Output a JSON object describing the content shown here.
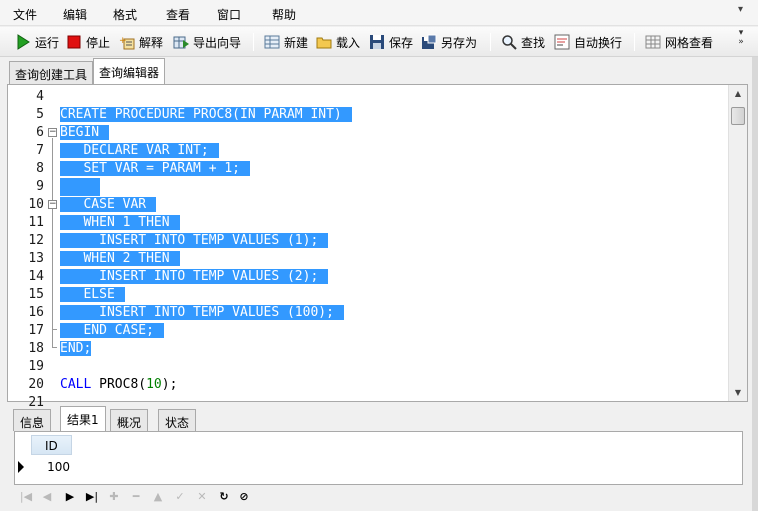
{
  "menu": [
    "文件",
    "编辑",
    "格式",
    "查看",
    "窗口",
    "帮助"
  ],
  "toolbar": {
    "run": "运行",
    "stop": "停止",
    "explain": "解释",
    "export_wizard": "导出向导",
    "new": "新建",
    "load": "载入",
    "save": "保存",
    "save_as": "另存为",
    "find": "查找",
    "word_wrap": "自动换行",
    "grid_view": "网格查看"
  },
  "top_tabs": [
    "查询创建工具",
    "查询编辑器"
  ],
  "editor": {
    "line_numbers": [
      "4",
      "5",
      "6",
      "7",
      "8",
      "9",
      "10",
      "11",
      "12",
      "13",
      "14",
      "15",
      "16",
      "17",
      "18",
      "19",
      "20",
      "21"
    ],
    "code": {
      "l5": "CREATE PROCEDURE PROC8(IN PARAM INT)",
      "l6": "BEGIN",
      "l7": "   DECLARE VAR INT;",
      "l8": "   SET VAR = PARAM + 1;",
      "l10": "   CASE VAR",
      "l11": "   WHEN 1 THEN",
      "l12": "     INSERT INTO TEMP VALUES (1);",
      "l13": "   WHEN 2 THEN",
      "l14": "     INSERT INTO TEMP VALUES (2);",
      "l15": "   ELSE",
      "l16": "     INSERT INTO TEMP VALUES (100);",
      "l17": "   END CASE;",
      "l18": "END;",
      "l20_kw": "CALL",
      "l20_fn": " PROC8(",
      "l20_num": "10",
      "l20_end": ");"
    },
    "colors": {
      "selection": "#3399ff",
      "keyword": "#0000ff",
      "number": "#008000"
    }
  },
  "bottom_tabs": [
    "信息",
    "结果1",
    "概况",
    "状态"
  ],
  "result": {
    "columns": [
      "ID"
    ],
    "rows": [
      [
        "100"
      ]
    ]
  },
  "navigator": [
    "first-record",
    "previous-record",
    "next-record",
    "last-record",
    "add-record",
    "delete-record",
    "edit-record",
    "post-edit",
    "cancel-edit",
    "refresh",
    "stop"
  ]
}
